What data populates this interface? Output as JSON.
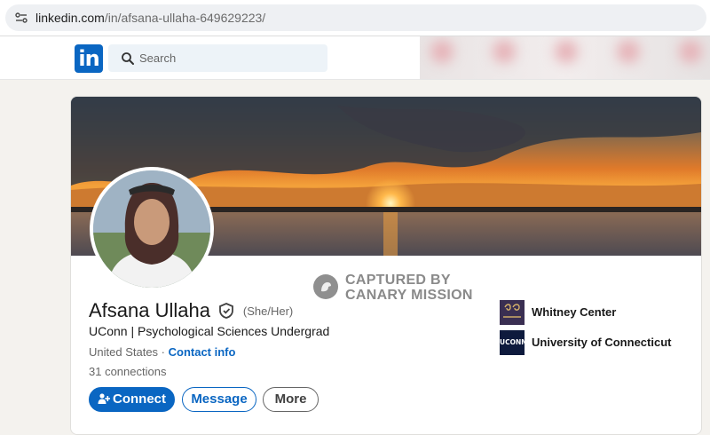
{
  "browser": {
    "url_host": "linkedin.com",
    "url_path": "/in/afsana-ullaha-649629223/"
  },
  "nav": {
    "logo_text": "in",
    "search_placeholder": "Search"
  },
  "watermark": {
    "line1": "CAPTURED BY",
    "line2": "CANARY MISSION"
  },
  "profile": {
    "name": "Afsana Ullaha",
    "pronouns": "(She/Her)",
    "headline": "UConn | Psychological Sciences Undergrad",
    "location": "United States",
    "separator": " · ",
    "contact_info": "Contact info",
    "connections": "31 connections"
  },
  "actions": {
    "connect": "Connect",
    "message": "Message",
    "more": "More"
  },
  "organizations": [
    {
      "name": "Whitney Center",
      "logo_text": "WHITNEY CENTER"
    },
    {
      "name": "University of Connecticut",
      "logo_text": "UCONN"
    }
  ],
  "colors": {
    "brand": "#0a66c2",
    "page_bg": "#f4f2ee"
  }
}
